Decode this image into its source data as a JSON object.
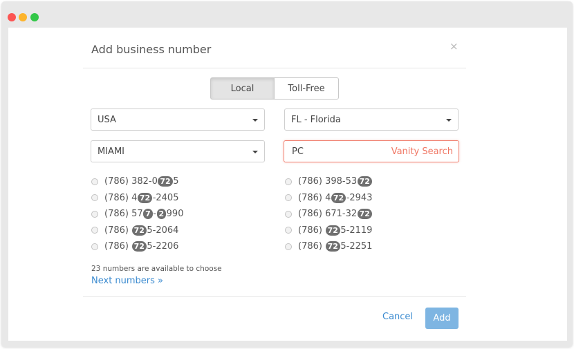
{
  "modal": {
    "title": "Add business number",
    "close_icon": "×"
  },
  "tabs": {
    "local": "Local",
    "toll_free": "Toll-Free",
    "selected": "Local"
  },
  "filters": {
    "country": "USA",
    "state": "FL - Florida",
    "city": "MIAMI",
    "vanity_value": "PC",
    "vanity_label": "Vanity Search"
  },
  "numbers_left": [
    [
      {
        "t": "(786) 382-0"
      },
      {
        "h": "72"
      },
      {
        "t": "5"
      }
    ],
    [
      {
        "t": "(786) 4"
      },
      {
        "h": "72"
      },
      {
        "t": "-2405"
      }
    ],
    [
      {
        "t": "(786) 57"
      },
      {
        "h": "7"
      },
      {
        "t": "-"
      },
      {
        "h": "2"
      },
      {
        "t": "990"
      }
    ],
    [
      {
        "t": "(786) "
      },
      {
        "h": "72"
      },
      {
        "t": "5-2064"
      }
    ],
    [
      {
        "t": "(786) "
      },
      {
        "h": "72"
      },
      {
        "t": "5-2206"
      }
    ]
  ],
  "numbers_right": [
    [
      {
        "t": "(786) 398-53"
      },
      {
        "h": "72"
      }
    ],
    [
      {
        "t": "(786) 4"
      },
      {
        "h": "72"
      },
      {
        "t": "-2943"
      }
    ],
    [
      {
        "t": "(786) 671-32"
      },
      {
        "h": "72"
      }
    ],
    [
      {
        "t": "(786) "
      },
      {
        "h": "72"
      },
      {
        "t": "5-2119"
      }
    ],
    [
      {
        "t": "(786) "
      },
      {
        "h": "72"
      },
      {
        "t": "5-2251"
      }
    ]
  ],
  "availability": "23 numbers are available to choose",
  "next_link": "Next numbers »",
  "footer": {
    "cancel": "Cancel",
    "add": "Add"
  },
  "colors": {
    "accent": "#3b8bd0",
    "add_button": "#7eb5e2",
    "vanity": "#f07663",
    "highlight_badge": "#6f6f6f"
  }
}
